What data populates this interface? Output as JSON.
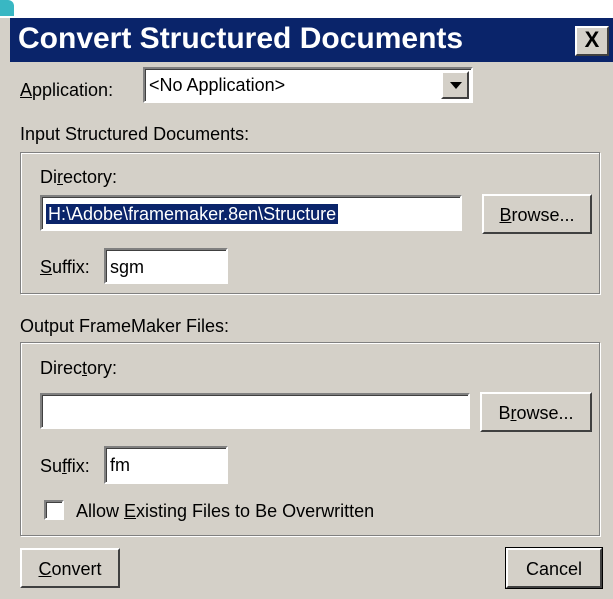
{
  "window": {
    "title": "Convert Structured Documents",
    "close_glyph": "X"
  },
  "application": {
    "label_ul": "A",
    "label_rest": "pplication:",
    "value": "<No Application>"
  },
  "input_section": {
    "label": "Input Structured Documents:",
    "directory_label_pre": "Di",
    "directory_label_ul": "r",
    "directory_label_post": "ectory:",
    "directory_value": "H:\\Adobe\\framemaker.8en\\Structure",
    "browse_pre": "",
    "browse_ul": "B",
    "browse_post": "rowse...",
    "suffix_label_ul": "S",
    "suffix_label_post": "uffix:",
    "suffix_value": "sgm"
  },
  "output_section": {
    "label": "Output FrameMaker Files:",
    "directory_label_pre": "Direc",
    "directory_label_ul": "t",
    "directory_label_post": "ory:",
    "directory_value": "",
    "browse_pre": "B",
    "browse_ul": "r",
    "browse_post": "owse...",
    "suffix_label_pre": "Su",
    "suffix_label_ul": "f",
    "suffix_label_post": "fix:",
    "suffix_value": "fm",
    "overwrite_label_pre": "Allow ",
    "overwrite_label_ul": "E",
    "overwrite_label_post": "xisting Files to Be Overwritten",
    "overwrite_checked": false
  },
  "footer": {
    "convert_ul": "C",
    "convert_post": "onvert",
    "cancel_label": "Cancel"
  },
  "colors": {
    "titlebar": "#0a246a",
    "dialog_bg": "#d4d0c8",
    "corner_accent": "#39b7c3"
  }
}
